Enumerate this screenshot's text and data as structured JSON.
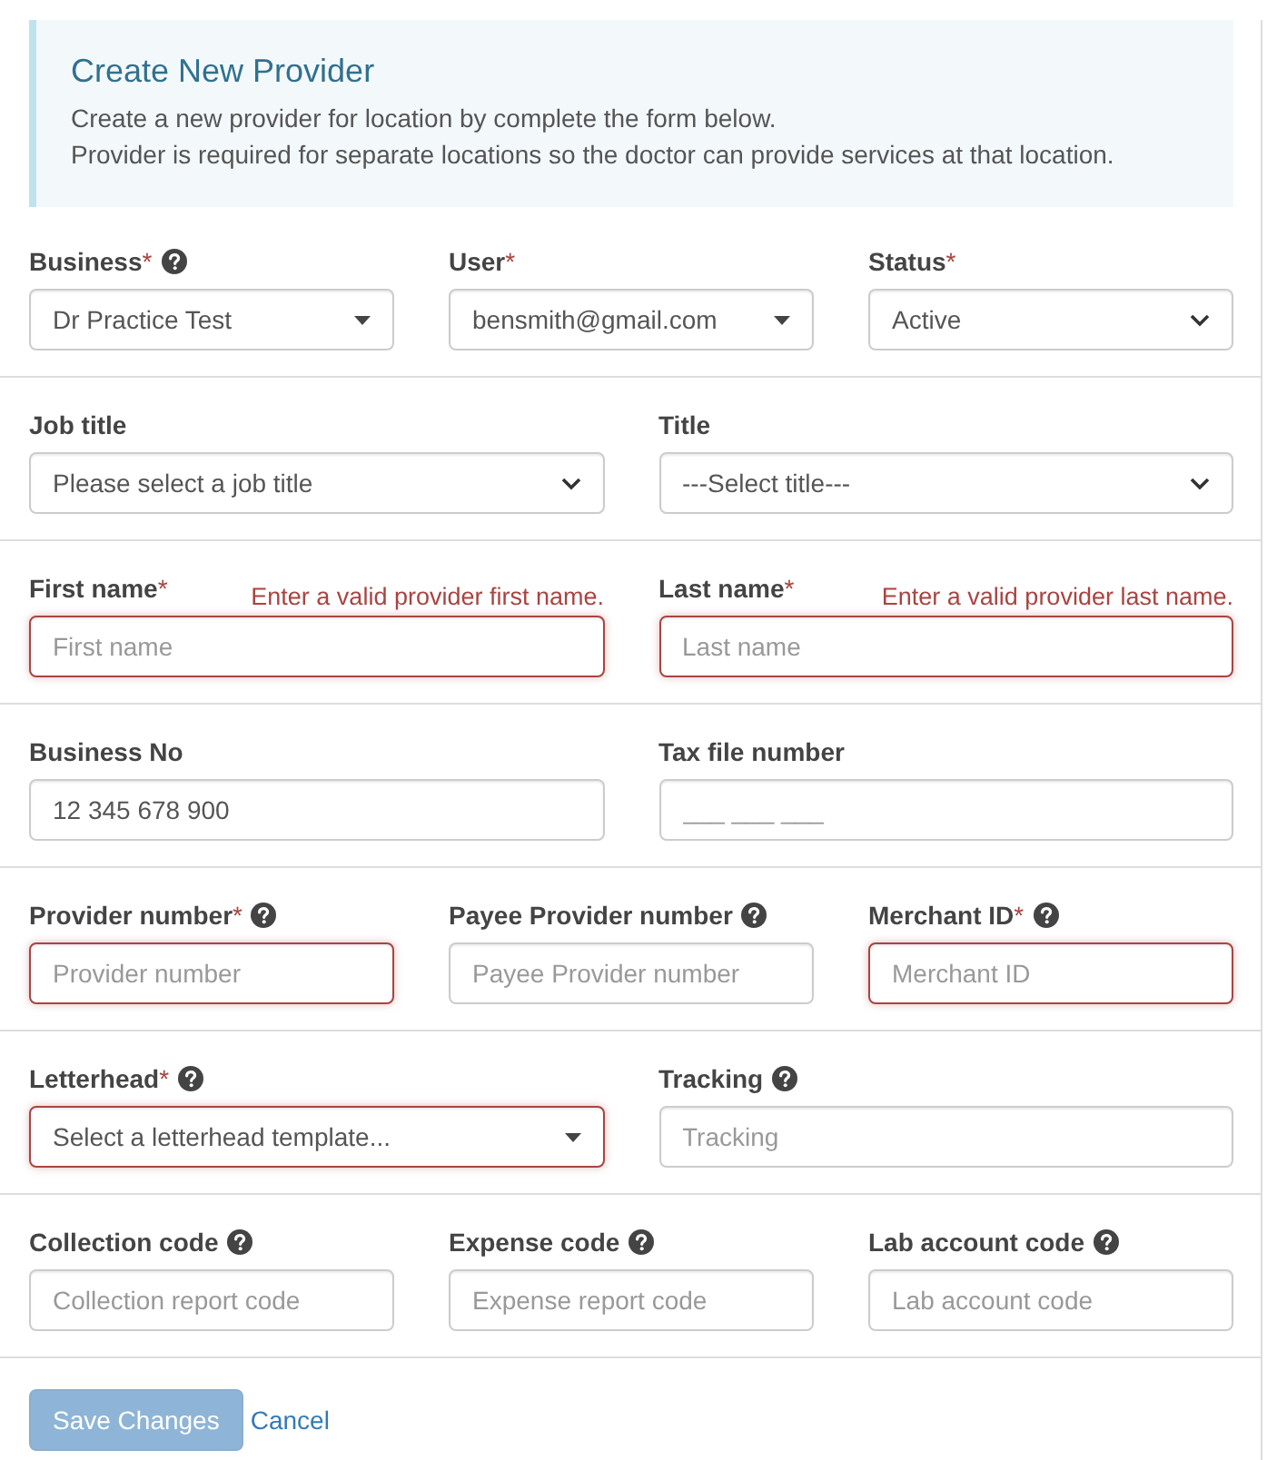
{
  "intro": {
    "title": "Create New Provider",
    "lines": [
      "Create a new provider for location by complete the form below.",
      "Provider is required for separate locations so the doctor can provide services at that location."
    ]
  },
  "rows": [
    {
      "fields": [
        {
          "kind": "combo",
          "label": "Business",
          "asterisk": "*",
          "help": true,
          "value": "Dr Practice Test",
          "invalid": false
        },
        {
          "kind": "combo",
          "label": "User",
          "asterisk": "*",
          "help": false,
          "value": "bensmith@gmail.com",
          "invalid": false
        },
        {
          "kind": "select",
          "label": "Status",
          "asterisk": "*",
          "help": false,
          "value": "Active",
          "invalid": false
        }
      ]
    },
    {
      "fields": [
        {
          "kind": "select",
          "label": "Job title",
          "help": false,
          "value": "Please select a job title",
          "invalid": false
        },
        {
          "kind": "select",
          "label": "Title",
          "help": false,
          "value": "---Select title---",
          "invalid": false
        }
      ]
    },
    {
      "fields": [
        {
          "kind": "input",
          "label": "First name",
          "asterisk": "*",
          "help": false,
          "error": "Enter a valid provider first name.",
          "placeholder": "First name",
          "invalid": true
        },
        {
          "kind": "input",
          "label": "Last name",
          "asterisk": "*",
          "help": false,
          "error": "Enter a valid provider last name.",
          "placeholder": "Last name",
          "invalid": true
        }
      ]
    },
    {
      "fields": [
        {
          "kind": "input",
          "label": "Business No",
          "help": false,
          "value": "12 345 678 900",
          "invalid": false
        },
        {
          "kind": "input",
          "label": "Tax file number",
          "help": false,
          "placeholder": "___ ___ ___",
          "invalid": false
        }
      ]
    },
    {
      "fields": [
        {
          "kind": "input",
          "label": "Provider number",
          "asterisk": "*",
          "help": true,
          "placeholder": "Provider number",
          "invalid": true
        },
        {
          "kind": "input",
          "label": "Payee Provider number",
          "help": true,
          "placeholder": "Payee Provider number",
          "invalid": false
        },
        {
          "kind": "input",
          "label": "Merchant ID",
          "asterisk": "*",
          "help": true,
          "placeholder": "Merchant ID",
          "invalid": true
        }
      ]
    },
    {
      "fields": [
        {
          "kind": "combo",
          "label": "Letterhead",
          "asterisk": "*",
          "help": true,
          "value": "Select a letterhead template...",
          "invalid": true
        },
        {
          "kind": "input",
          "label": "Tracking",
          "help": true,
          "placeholder": "Tracking",
          "invalid": false
        }
      ]
    },
    {
      "fields": [
        {
          "kind": "input",
          "label": "Collection code",
          "help": true,
          "placeholder": "Collection report code",
          "invalid": false
        },
        {
          "kind": "input",
          "label": "Expense code",
          "help": true,
          "placeholder": "Expense report code",
          "invalid": false
        },
        {
          "kind": "input",
          "label": "Lab account code",
          "help": true,
          "placeholder": "Lab account code",
          "invalid": false
        }
      ]
    }
  ],
  "actions": [
    {
      "kind": "button",
      "label": "Save Changes",
      "disabled": true
    },
    {
      "kind": "link",
      "label": "Cancel"
    }
  ]
}
